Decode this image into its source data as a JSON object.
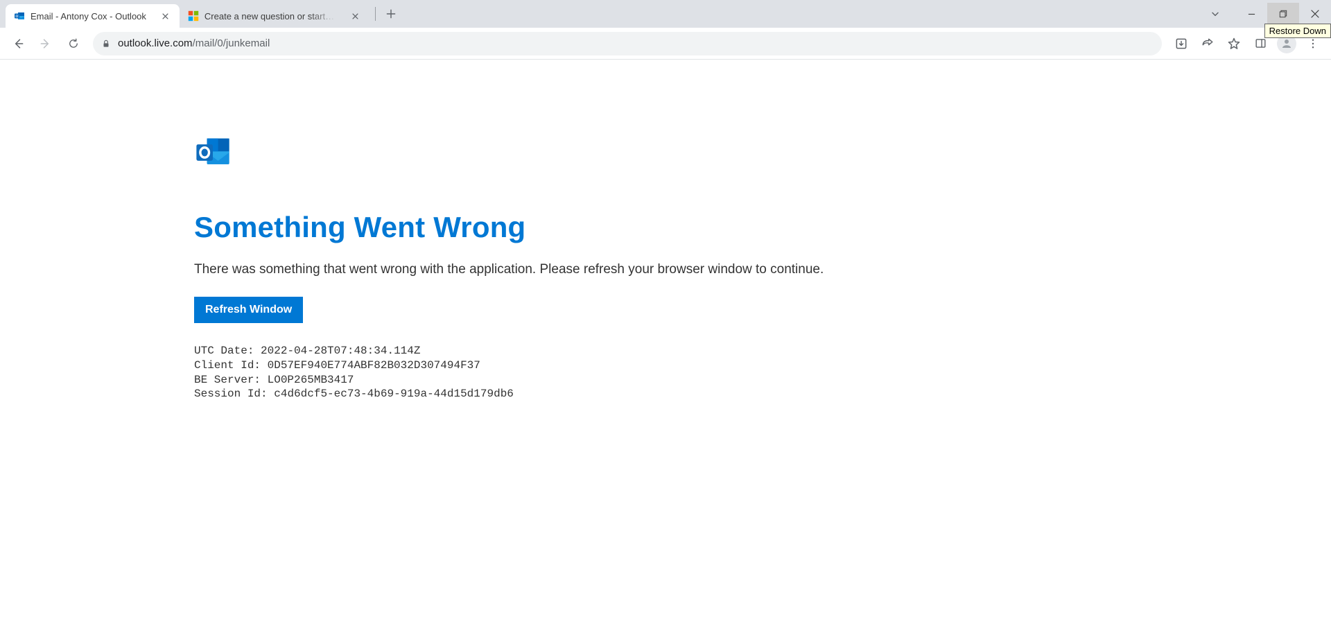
{
  "window": {
    "tooltip": "Restore Down"
  },
  "tabs": [
    {
      "title": "Email - Antony Cox - Outlook"
    },
    {
      "title": "Create a new question or start a ..."
    }
  ],
  "address": {
    "host": "outlook.live.com",
    "path": "/mail/0/junkemail"
  },
  "page": {
    "heading": "Something Went Wrong",
    "message": "There was something that went wrong with the application. Please refresh your browser window to continue.",
    "button": "Refresh Window",
    "diag": {
      "utc_label": "UTC Date:",
      "utc_value": "2022-04-28T07:48:34.114Z",
      "client_label": "Client Id:",
      "client_value": "0D57EF940E774ABF82B032D307494F37",
      "be_label": "BE Server:",
      "be_value": "LO0P265MB3417",
      "session_label": "Session Id:",
      "session_value": "c4d6dcf5-ec73-4b69-919a-44d15d179db6"
    }
  }
}
